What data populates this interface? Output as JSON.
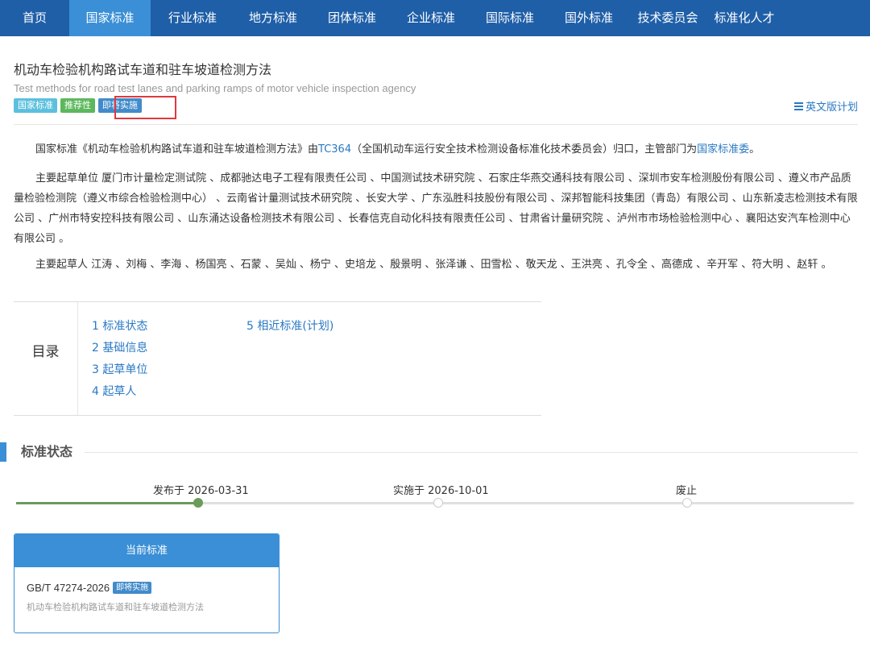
{
  "nav": {
    "items": [
      {
        "label": "首页"
      },
      {
        "label": "国家标准"
      },
      {
        "label": "行业标准"
      },
      {
        "label": "地方标准"
      },
      {
        "label": "团体标准"
      },
      {
        "label": "企业标准"
      },
      {
        "label": "国际标准"
      },
      {
        "label": "国外标准"
      },
      {
        "label": "技术委员会"
      },
      {
        "label": "标准化人才"
      }
    ],
    "active": "国家标准"
  },
  "standard": {
    "title_cn": "机动车检验机构路试车道和驻车坡道检测方法",
    "title_en": "Test methods for road test lanes and parking ramps of motor vehicle inspection agency",
    "badges": [
      "国家标准",
      "推荐性",
      "即将实施"
    ],
    "english_plan_link": "英文版计划"
  },
  "intro": {
    "p1_pre": "国家标准《机动车检验机构路试车道和驻车坡道检测方法》由",
    "p1_tc": "TC364",
    "p1_mid": "（全国机动车运行安全技术检测设备标准化技术委员会）归口，主管部门为",
    "p1_dept": "国家标准委",
    "p1_end": "。",
    "p2": "主要起草单位 厦门市计量检定测试院 、成都驰达电子工程有限责任公司 、中国测试技术研究院 、石家庄华燕交通科技有限公司 、深圳市安车检测股份有限公司 、遵义市产品质量检验检测院（遵义市综合检验检测中心） 、云南省计量测试技术研究院 、长安大学 、广东泓胜科技股份有限公司 、深邦智能科技集团（青岛）有限公司 、山东新凌志检测技术有限公司 、广州市特安控科技有限公司 、山东涌达设备检测技术有限公司 、长春信克自动化科技有限责任公司 、甘肃省计量研究院 、泸州市市场检验检测中心 、襄阳达安汽车检测中心有限公司 。",
    "p3": "主要起草人 江涛 、刘梅 、李海 、杨国亮 、石蒙 、吴灿 、杨宁 、史培龙 、殷景明 、张泽谦 、田雪松 、敬天龙 、王洪亮 、孔令全 、高德成 、辛开军 、符大明 、赵轩 。"
  },
  "toc": {
    "label": "目录",
    "items": [
      {
        "label": "1  标准状态"
      },
      {
        "label": "2  基础信息"
      },
      {
        "label": "3  起草单位"
      },
      {
        "label": "4  起草人"
      },
      {
        "label": "5  相近标准(计划)"
      }
    ]
  },
  "status_section": {
    "title": "标准状态",
    "timeline": [
      {
        "label": "发布于 2026-03-31",
        "reached": true
      },
      {
        "label": "实施于 2026-10-01",
        "reached": false
      },
      {
        "label": "废止",
        "reached": false
      }
    ]
  },
  "current_card": {
    "header": "当前标准",
    "code": "GB/T 47274-2026",
    "badge": "即将实施",
    "name": "机动车检验机构路试车道和驻车坡道检测方法"
  },
  "colors": {
    "nav_bg": "#1f5fa8",
    "nav_active": "#3a8fd6",
    "link": "#2a79c4",
    "highlight_box": "#e0383e",
    "timeline_done": "#6b9c5a"
  }
}
